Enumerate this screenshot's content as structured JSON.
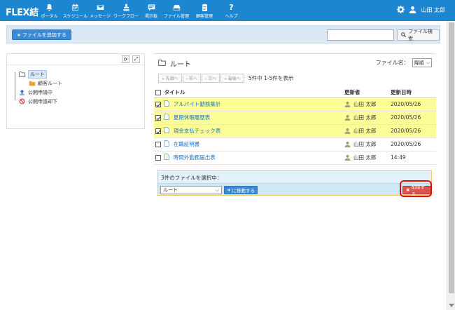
{
  "app": {
    "logo": "FLEX結",
    "nav": [
      {
        "label": "ポータル",
        "icon": "bell-icon"
      },
      {
        "label": "スケジュール",
        "icon": "calendar-icon"
      },
      {
        "label": "メッセージ",
        "icon": "envelope-icon"
      },
      {
        "label": "ワークフロー",
        "icon": "stamp-icon"
      },
      {
        "label": "掲示板",
        "icon": "board-icon"
      },
      {
        "label": "ファイル管理",
        "icon": "drive-icon"
      },
      {
        "label": "顧客管理",
        "icon": "clipboard-icon"
      },
      {
        "label": "ヘルプ",
        "icon": "question-icon"
      }
    ],
    "user_name": "山田 太郎"
  },
  "toolbar": {
    "add_file_label": "ファイルを追加する",
    "search_placeholder": "",
    "search_button_label": "ファイル検索"
  },
  "tree": {
    "items": [
      {
        "label": "ルート",
        "icon": "folder-open-icon",
        "selected": true
      },
      {
        "label": "顧客ルート",
        "icon": "folder-icon"
      },
      {
        "label": "公開申請中",
        "icon": "upload-icon"
      },
      {
        "label": "公開申請却下",
        "icon": "ban-icon"
      }
    ]
  },
  "file_panel": {
    "title": "ルート",
    "sort_label": "ファイル名：",
    "sort_value": "降順",
    "pager": {
      "first": "« 先頭へ",
      "prev": "‹ 前へ",
      "next": "› 次へ",
      "last": "» 最後へ",
      "info": "5件中 1-5件を表示"
    },
    "columns": {
      "title": "タイトル",
      "updater": "更新者",
      "updated_at": "更新日時"
    },
    "rows": [
      {
        "title": "アルバイト勤務集計",
        "updater": "山田 太郎",
        "updated_at": "2020/05/26",
        "checked": true
      },
      {
        "title": "夏期休暇履歴表",
        "updater": "山田 太郎",
        "updated_at": "2020/05/26",
        "checked": true
      },
      {
        "title": "現金支払チェック表",
        "updater": "山田 太郎",
        "updated_at": "2020/05/26",
        "checked": true
      },
      {
        "title": "在職証明書",
        "updater": "山田 太郎",
        "updated_at": "2020/05/26",
        "checked": false
      },
      {
        "title": "時間外勤務届出表",
        "updater": "山田 太郎",
        "updated_at": "14:49",
        "checked": false
      }
    ]
  },
  "selection": {
    "title": "3件のファイルを選択中：",
    "destination_value": "ルート",
    "move_label": "に移動する",
    "delete_label": "削除する"
  },
  "colors": {
    "nav_bg": "#1c86d1",
    "highlight_row": "#fdfd98",
    "primary_button": "#3b8ad6",
    "danger_button": "#d9534f"
  }
}
